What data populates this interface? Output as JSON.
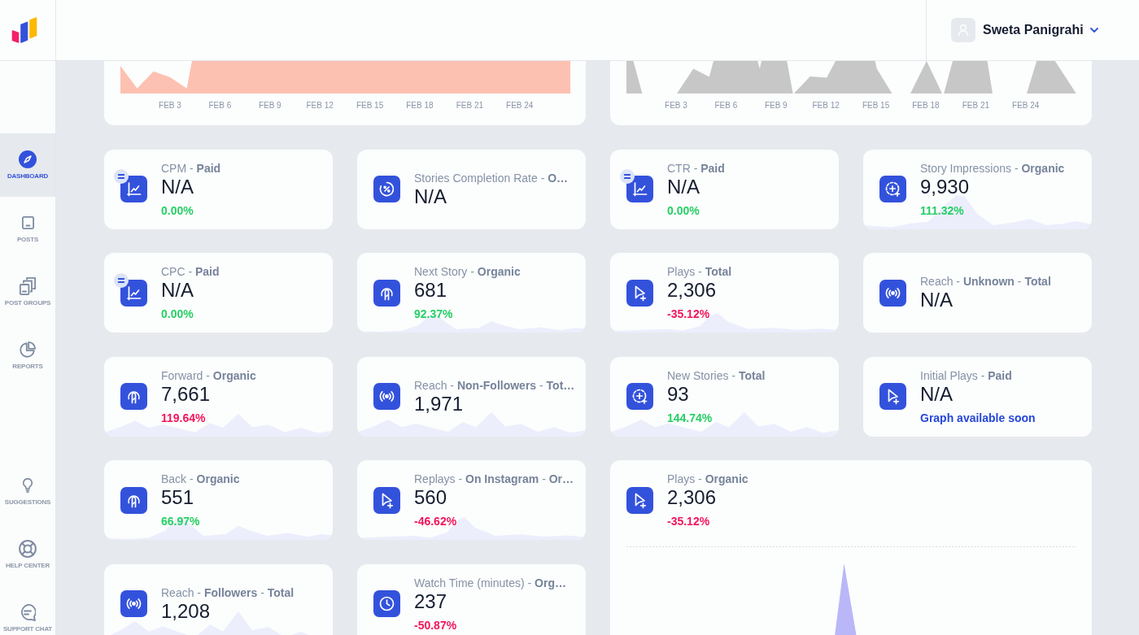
{
  "header": {
    "user_name": "Sweta Panigrahi"
  },
  "sidebar": {
    "main_items": [
      {
        "label": "DASHBOARD",
        "selected": true
      },
      {
        "label": "POSTS",
        "selected": false
      },
      {
        "label": "POST GROUPS",
        "selected": false
      },
      {
        "label": "REPORTS",
        "selected": false
      }
    ],
    "bottom_items": [
      {
        "label": "SUGGESTIONS",
        "selected": false
      },
      {
        "label": "HELP CENTER",
        "selected": false
      },
      {
        "label": "SUPPORT CHAT",
        "selected": false
      }
    ]
  },
  "top_charts": [
    {
      "axis_labels": [
        "FEB 3",
        "FEB 6",
        "FEB 9",
        "FEB 12",
        "FEB 15",
        "FEB 18",
        "FEB 21",
        "FEB 24"
      ]
    },
    {
      "axis_labels": [
        "FEB 3",
        "FEB 6",
        "FEB 9",
        "FEB 12",
        "FEB 15",
        "FEB 18",
        "FEB 21",
        "FEB 24"
      ]
    }
  ],
  "cards": [
    {
      "kind": "metric",
      "title": "CPM - **Paid**",
      "value": "N/A",
      "change": "0.00%",
      "color": "#27cf66",
      "badge": true,
      "sparkline": false
    },
    {
      "kind": "metric",
      "title": "Stories Completion Rate - **O…**",
      "value": "N/A",
      "badge": false,
      "sparkline": false
    },
    {
      "kind": "metric",
      "title": "CTR - **Paid**",
      "value": "N/A",
      "change": "0.00%",
      "color": "#27cf66",
      "badge": true,
      "sparkline": false
    },
    {
      "kind": "metric",
      "title": "Story Impressions - **Organic**",
      "value": "9,930",
      "change": "111.32%",
      "color": "#27cf66",
      "badge": false,
      "sparkline": true
    },
    {
      "kind": "metric",
      "title": "CPC - **Paid**",
      "value": "N/A",
      "change": "0.00%",
      "color": "#27cf66",
      "badge": true,
      "sparkline": false
    },
    {
      "kind": "metric",
      "title": "Next Story - **Organic**",
      "value": "681",
      "change": "92.37%",
      "color": "#27cf66",
      "badge": false,
      "sparkline": true
    },
    {
      "kind": "metric",
      "title": "Plays - **Total**",
      "value": "2,306",
      "change": "-35.12%",
      "color": "#f2155b",
      "badge": false,
      "sparkline": true
    },
    {
      "kind": "metric",
      "title": "Reach - **Unknown** - **Total**",
      "value": "N/A",
      "badge": false,
      "sparkline": false
    },
    {
      "kind": "metric",
      "title": "Forward - **Organic**",
      "value": "7,661",
      "change": "119.64%",
      "color": "#f2155b",
      "badge": false,
      "sparkline": true
    },
    {
      "kind": "metric",
      "title": "Reach - **Non-Followers** - **Tot…**",
      "value": "1,971",
      "badge": false,
      "sparkline": true
    },
    {
      "kind": "metric",
      "title": "New Stories - **Total**",
      "value": "93",
      "change": "144.74%",
      "color": "#27cf66",
      "badge": false,
      "sparkline": true
    },
    {
      "kind": "metric",
      "title": "Initial Plays - **Paid**",
      "value": "N/A",
      "note": "Graph available soon",
      "badge": false,
      "sparkline": false
    },
    {
      "kind": "metric",
      "title": "Back - **Organic**",
      "value": "551",
      "change": "66.97%",
      "color": "#27cf66",
      "badge": false,
      "sparkline": true
    },
    {
      "kind": "metric",
      "title": "Replays - **On Instagram** - **Or…**",
      "value": "560",
      "change": "-46.62%",
      "color": "#f2155b",
      "badge": false,
      "sparkline": true
    },
    {
      "kind": "featured",
      "title": "Plays - **Organic**",
      "value": "2,306",
      "change": "-35.12%",
      "color": "#f2155b",
      "badge": false,
      "sparkline": false
    },
    {
      "kind": "metric",
      "title": "Reach - **Followers** - **Total**",
      "value": "1,208",
      "badge": false,
      "sparkline": true
    },
    {
      "kind": "metric",
      "title": "Watch Time (minutes) - **Org…**",
      "value": "237",
      "change": "-50.87%",
      "color": "#f2155b",
      "badge": false,
      "sparkline": false
    }
  ]
}
